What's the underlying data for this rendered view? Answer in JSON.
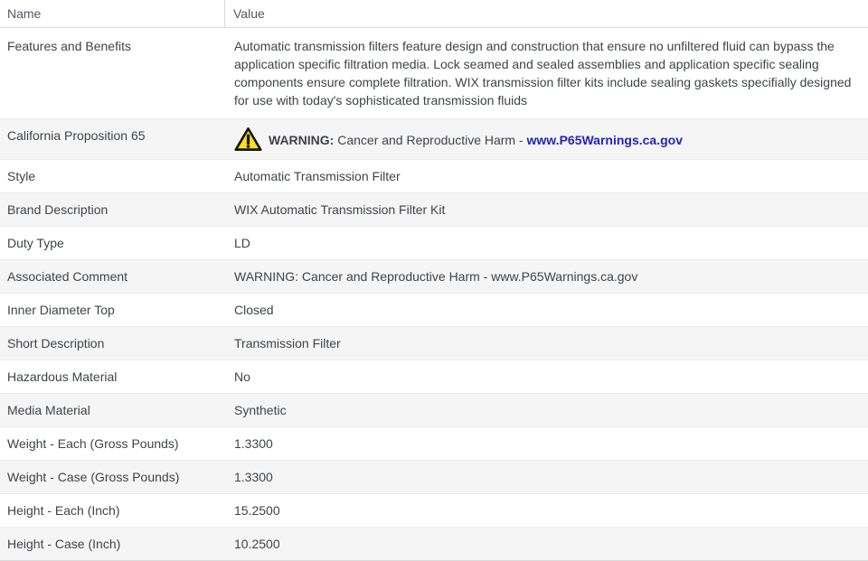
{
  "table": {
    "columns": {
      "name": "Name",
      "value": "Value"
    },
    "colors": {
      "link_blue": "#2424b6",
      "warning_yellow": "#F7E017",
      "alt_row_bg": "#f5f5f5"
    },
    "rows": [
      {
        "name": "Features and Benefits",
        "value": "Automatic transmission filters feature design and construction that ensure no unfiltered fluid can bypass the application specific filtration media. Lock seamed and sealed assemblies and application specific sealing components ensure complete filtration. WIX transmission filter kits include sealing gaskets specifially designed for use with today's sophisticated transmission fluids"
      },
      {
        "name": "California Proposition 65",
        "type": "warning",
        "icon": "warning-triangle-icon",
        "warning_label": "WARNING:",
        "warning_text": "Cancer and Reproductive Harm -",
        "link_label": "www.P65Warnings.ca.gov"
      },
      {
        "name": "Style",
        "value": "Automatic Transmission Filter"
      },
      {
        "name": "Brand Description",
        "value": "WIX Automatic Transmission Filter Kit"
      },
      {
        "name": "Duty Type",
        "value": "LD"
      },
      {
        "name": "Associated Comment",
        "value": "WARNING: Cancer and Reproductive Harm - www.P65Warnings.ca.gov"
      },
      {
        "name": "Inner Diameter Top",
        "value": "Closed"
      },
      {
        "name": "Short Description",
        "value": "Transmission Filter"
      },
      {
        "name": "Hazardous Material",
        "value": "No"
      },
      {
        "name": "Media Material",
        "value": "Synthetic"
      },
      {
        "name": "Weight - Each (Gross Pounds)",
        "value": "1.3300"
      },
      {
        "name": "Weight - Case (Gross Pounds)",
        "value": "1.3300"
      },
      {
        "name": "Height - Each (Inch)",
        "value": "15.2500"
      },
      {
        "name": "Height - Case (Inch)",
        "value": "10.2500"
      }
    ]
  }
}
